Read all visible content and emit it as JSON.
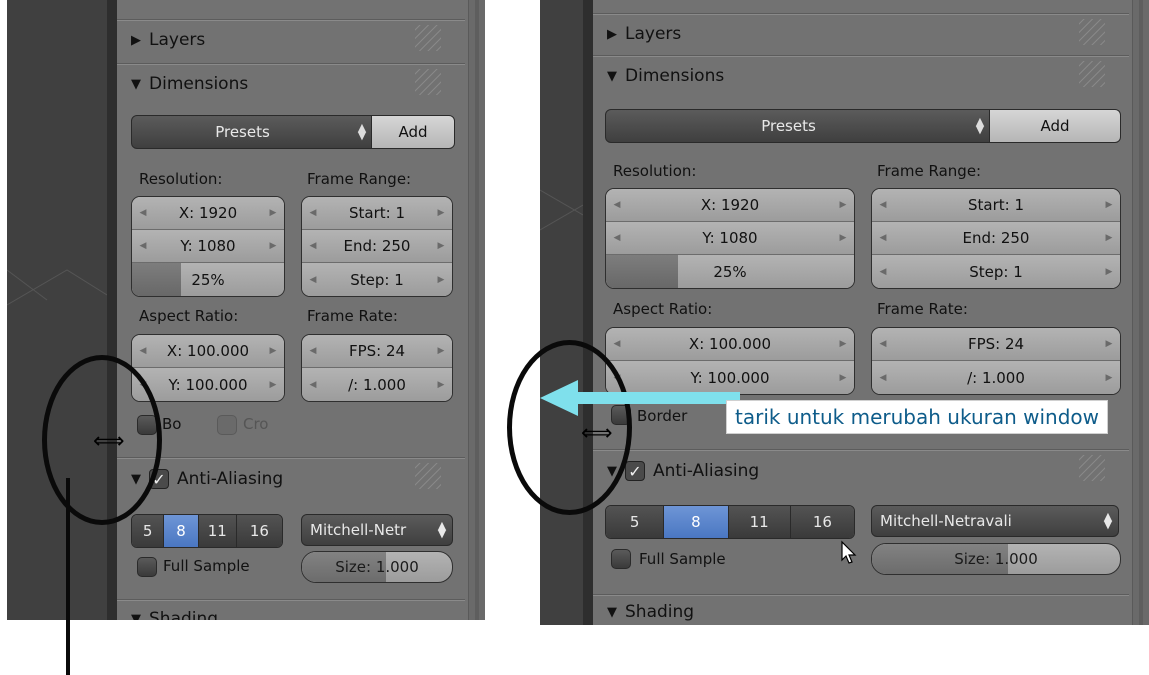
{
  "panels": {
    "layers": "Layers",
    "dimensions": "Dimensions",
    "anti_aliasing": "Anti-Aliasing",
    "shading": "Shading"
  },
  "presets": {
    "label": "Presets",
    "add": "Add"
  },
  "labels": {
    "resolution": "Resolution:",
    "frame_range": "Frame Range:",
    "aspect_ratio": "Aspect Ratio:",
    "frame_rate": "Frame Rate:"
  },
  "fields": {
    "res_x": "X: 1920",
    "res_y": "Y: 1080",
    "res_pct": "25%",
    "res_pct_value": 0.25,
    "start": "Start: 1",
    "end": "End: 250",
    "step": "Step: 1",
    "aspect_x": "X: 100.000",
    "aspect_y": "Y: 100.000",
    "fps": "FPS: 24",
    "fps_base": "/: 1.000",
    "size": "Size: 1.000"
  },
  "left": {
    "border_label": "Bo",
    "crop_label": "Cro",
    "filter": "Mitchell-Netr",
    "full_sample": "Full Sample"
  },
  "right": {
    "border_label": "Border",
    "filter": "Mitchell-Netravali",
    "full_sample": "Full Sample",
    "tooltip": "tarik untuk merubah ukuran window"
  },
  "aa_samples": [
    "5",
    "8",
    "11",
    "16"
  ],
  "aa_selected": "8",
  "colors": {
    "accent": "#5a84cc",
    "arrow": "#7fe0ec",
    "tooltip_text": "#0e5c8a"
  },
  "icons": [
    "triangle-right-icon",
    "triangle-down-icon",
    "checkbox-icon",
    "resize-horizontal-cursor-icon",
    "mouse-pointer-icon",
    "arrow-left-icon"
  ]
}
